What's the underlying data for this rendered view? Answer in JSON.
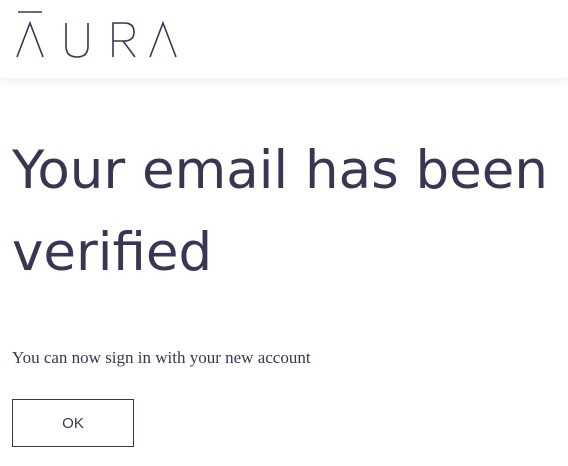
{
  "header": {
    "logo_text": "AURA"
  },
  "main": {
    "heading": "Your email has been verified",
    "subtext": "You can now sign in with your new account",
    "ok_label": "OK"
  },
  "colors": {
    "text": "#3b3553",
    "background": "#ffffff",
    "button_border": "#3b3553"
  }
}
